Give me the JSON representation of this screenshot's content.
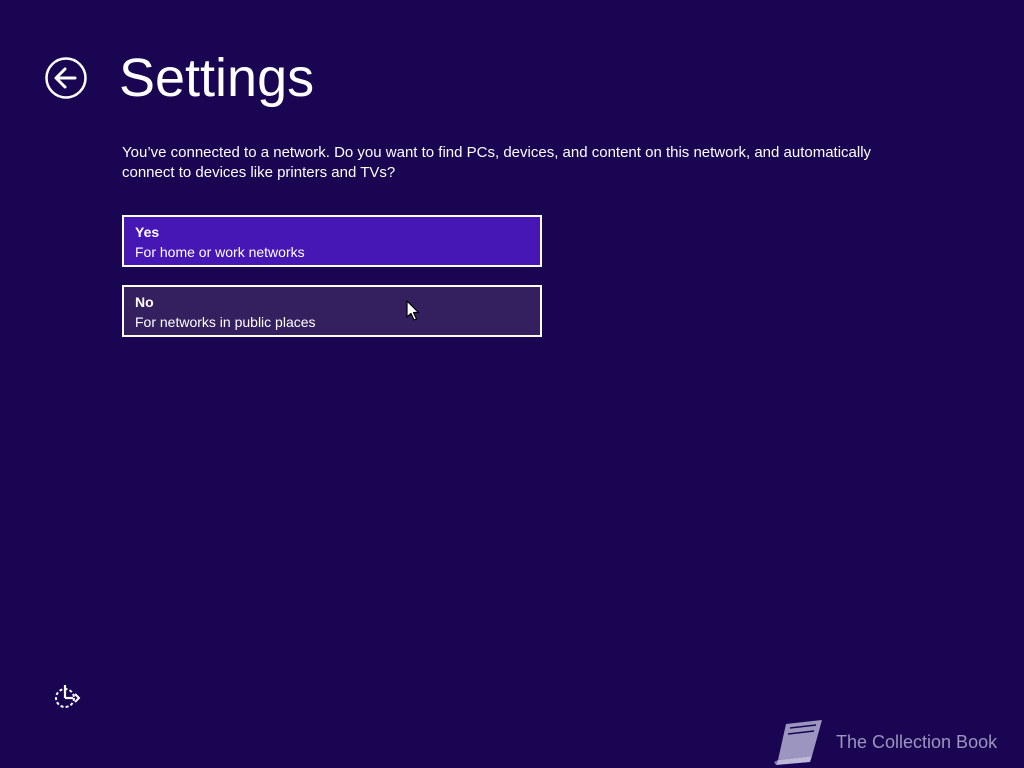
{
  "header": {
    "title": "Settings",
    "back_icon": "back-arrow-circle-icon"
  },
  "prompt": {
    "text": "You’ve connected to a network. Do you want to find PCs, devices, and content on this network, and automatically connect to devices like printers and TVs?"
  },
  "options": [
    {
      "title": "Yes",
      "description": "For home or work networks",
      "selected": true,
      "color": "#4617b4"
    },
    {
      "title": "No",
      "description": "For networks in public places",
      "selected": false,
      "color": "#35205f"
    }
  ],
  "footer": {
    "ease_of_access_icon": "ease-of-access-icon"
  },
  "watermark": {
    "text": "The Collection Book",
    "icon": "book-icon"
  },
  "colors": {
    "background": "#1a0552",
    "accent": "#4617b4",
    "border": "#ffffff"
  }
}
